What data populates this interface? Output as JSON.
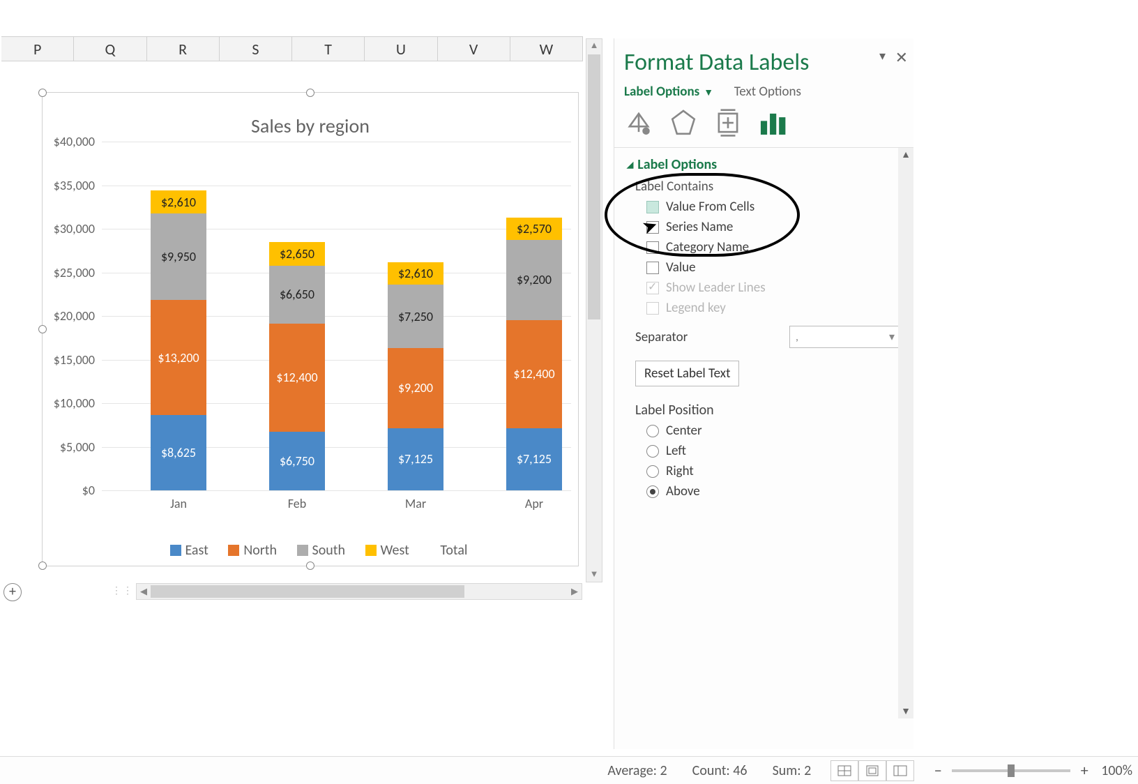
{
  "columns": [
    "P",
    "Q",
    "R",
    "S",
    "T",
    "U",
    "V",
    "W"
  ],
  "chart_data": {
    "type": "bar",
    "stacked": true,
    "title": "Sales by region",
    "xlabel": "",
    "ylabel": "",
    "ylim": [
      0,
      40000
    ],
    "ytick_step": 5000,
    "yticks": [
      "$0",
      "$5,000",
      "$10,000",
      "$15,000",
      "$20,000",
      "$25,000",
      "$30,000",
      "$35,000",
      "$40,000"
    ],
    "categories": [
      "Jan",
      "Feb",
      "Mar",
      "Apr"
    ],
    "series": [
      {
        "name": "East",
        "color": "#4A89C8",
        "values": [
          8625,
          6750,
          7125,
          7125
        ]
      },
      {
        "name": "North",
        "color": "#E5752B",
        "values": [
          13200,
          12400,
          9200,
          12400
        ]
      },
      {
        "name": "South",
        "color": "#ADADAD",
        "values": [
          9950,
          6650,
          7250,
          9200
        ]
      },
      {
        "name": "West",
        "color": "#FFC000",
        "values": [
          2610,
          2650,
          2610,
          2570
        ]
      }
    ],
    "legend_extra": "Total",
    "data_labels": [
      [
        "$8,625",
        "$13,200",
        "$9,950",
        "$2,610"
      ],
      [
        "$6,750",
        "$12,400",
        "$6,650",
        "$2,650"
      ],
      [
        "$7,125",
        "$9,200",
        "$7,250",
        "$2,610"
      ],
      [
        "$7,125",
        "$12,400",
        "$9,200",
        "$2,570"
      ]
    ]
  },
  "pane": {
    "title": "Format Data Labels",
    "tab_label_options": "Label Options",
    "tab_text_options": "Text Options",
    "section_label_options": "Label Options",
    "label_contains": "Label Contains",
    "opt_value_from_cells": "Value From Cells",
    "opt_series_name": "Series Name",
    "opt_category_name": "Category Name",
    "opt_value": "Value",
    "opt_show_leader_lines": "Show Leader Lines",
    "opt_legend_key": "Legend key",
    "separator_label": "Separator",
    "separator_value": ",",
    "reset_label": "Reset Label Text",
    "label_position": "Label Position",
    "pos_center": "Center",
    "pos_left": "Left",
    "pos_right": "Right",
    "pos_above": "Above"
  },
  "status": {
    "average_label": "Average:",
    "average_value": "2",
    "count_label": "Count:",
    "count_value": "46",
    "sum_label": "Sum:",
    "sum_value": "2",
    "zoom_pct": "100%"
  }
}
